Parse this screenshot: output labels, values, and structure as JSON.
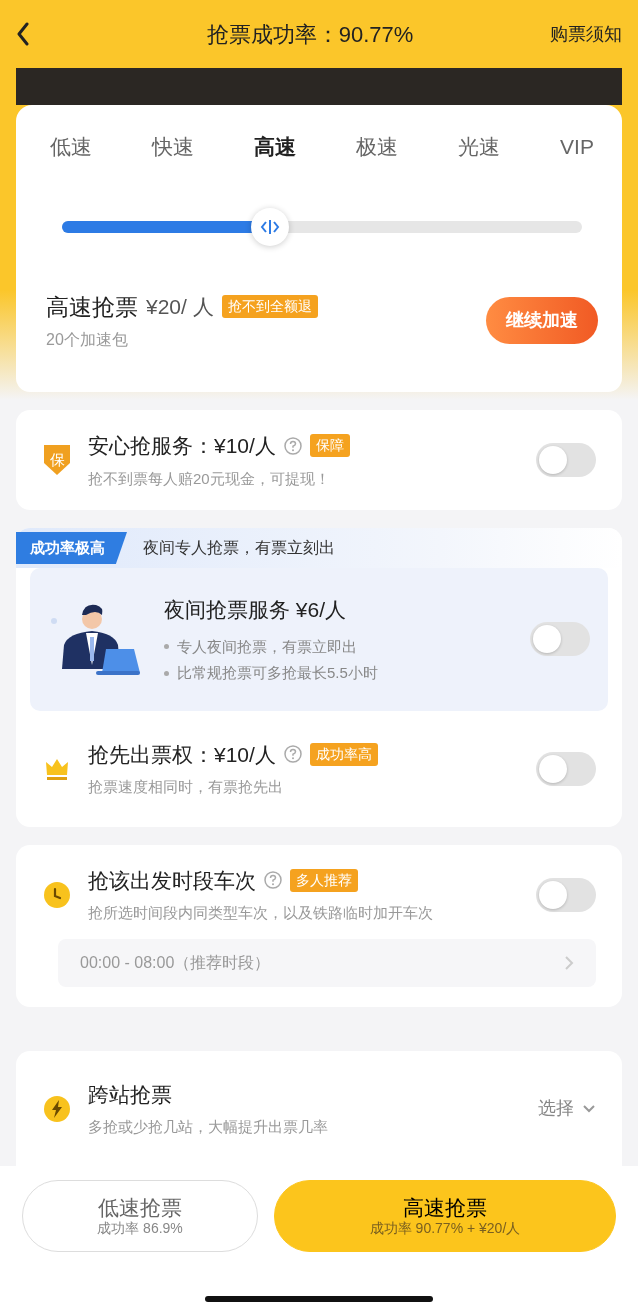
{
  "header": {
    "title": "抢票成功率：90.77%",
    "link": "购票须知"
  },
  "speed": {
    "tabs": [
      {
        "label": "低速",
        "selected": false
      },
      {
        "label": "快速",
        "selected": false
      },
      {
        "label": "高速",
        "selected": true
      },
      {
        "label": "极速",
        "selected": false
      },
      {
        "label": "光速",
        "selected": false
      },
      {
        "label": "VIP",
        "selected": false
      }
    ],
    "level": 0.4,
    "plan": {
      "title": "高速抢票",
      "price": "¥20/ 人",
      "badge": "抢不到全额退",
      "note": "20个加速包",
      "button": "继续加速"
    }
  },
  "services": [
    {
      "kind": "guarantee",
      "icon_text": "保",
      "title": "安心抢服务：¥10/人",
      "help": true,
      "badge": "保障",
      "sub": "抢不到票每人赔20元现金，可提现！",
      "on": false
    },
    {
      "kind": "night",
      "tag": "成功率极高",
      "headline": "夜间专人抢票，有票立刻出",
      "title": "夜间抢票服务 ¥6/人",
      "bullets": [
        "专人夜间抢票，有票立即出",
        "比常规抢票可多抢最长5.5小时"
      ],
      "on": false,
      "extra": {
        "title": "抢先出票权：¥10/人",
        "help": true,
        "badge": "成功率高",
        "sub": "抢票速度相同时，有票抢先出",
        "on": false
      }
    },
    {
      "kind": "timeslot",
      "title": "抢该出发时段车次",
      "help": true,
      "badge": "多人推荐",
      "sub": "抢所选时间段内同类型车次，以及铁路临时加开车次",
      "on": false,
      "slot": "00:00 - 08:00（推荐时段）"
    },
    {
      "kind": "cross",
      "title": "跨站抢票",
      "sub": "多抢或少抢几站，大幅提升出票几率",
      "action": "选择"
    }
  ],
  "bottom_buttons": [
    {
      "title": "低速抢票",
      "sub": "成功率 86.9%",
      "selected": false
    },
    {
      "title": "高速抢票",
      "sub": "成功率 90.77% + ¥20/人",
      "selected": true
    }
  ]
}
